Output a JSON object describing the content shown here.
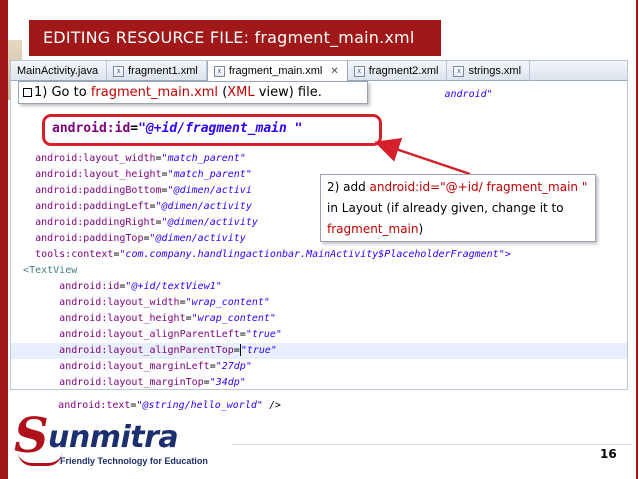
{
  "slide": {
    "title": "EDITING RESOURCE FILE: fragment_main.xml",
    "page_number": "16",
    "colors": {
      "accent": "#a01818",
      "callout_border": "#d4202a",
      "xml_value": "#2a00ff",
      "xml_attr": "#7f007f"
    }
  },
  "tabs": [
    {
      "label": "MainActivity.java",
      "active": false
    },
    {
      "label": "fragment1.xml",
      "active": false
    },
    {
      "label": "fragment_main.xml",
      "active": true
    },
    {
      "label": "fragment2.xml",
      "active": false
    },
    {
      "label": "strings.xml",
      "active": false
    }
  ],
  "code_lines": [
    {
      "attr": "android:layout_width",
      "val": "\"match_parent\""
    },
    {
      "attr": "android:layout_height",
      "val": "\"match_parent\""
    },
    {
      "attr": "android:paddingBottom",
      "val": "\"@dimen/activi"
    },
    {
      "attr": "android:paddingLeft",
      "val": "\"@dimen/activity"
    },
    {
      "attr": "android:paddingRight",
      "val": "\"@dimen/activity"
    },
    {
      "attr": "android:paddingTop",
      "val": "\"@dimen/activity"
    },
    {
      "attr": "tools:context",
      "val": "\"com.company.handlingactionbar.MainActivity$PlaceholderFragment\">"
    },
    {
      "tag": "<TextView"
    },
    {
      "attr": "android:id",
      "val": "\"@+id/textView1\""
    },
    {
      "attr": "android:layout_width",
      "val": "\"wrap_content\""
    },
    {
      "attr": "android:layout_height",
      "val": "\"wrap_content\""
    },
    {
      "attr": "android:layout_alignParentLeft",
      "val": "\"true\""
    },
    {
      "attr": "android:layout_alignParentTop",
      "val": "\"true\""
    },
    {
      "attr": "android:layout_marginLeft",
      "val": "\"27dp\""
    },
    {
      "attr": "android:layout_marginTop",
      "val": "\"34dp\""
    },
    {
      "attr": "android:text",
      "val": "\"@string/hello_world\"",
      "tail": " />"
    }
  ],
  "step1": {
    "prefix": "1) Go to ",
    "file": "fragment_main.xml",
    "paren_open": " (",
    "mode": "XML",
    "suffix": " view) file.",
    "behind_text": "android\""
  },
  "highlight": {
    "attr": "android:id",
    "equals": "=",
    "value": "\"@+id/fragment_main \""
  },
  "step2": {
    "t1": "2) add ",
    "r1": "android:id=\"@+id/",
    "r2": "fragment_main \"",
    "t2": " in  Layout (if already given, change it to ",
    "r3": "fragment_main",
    "t3": ")"
  },
  "logo": {
    "letter": "S",
    "word": "unmitra",
    "tagline": "Friendly Technology for Education"
  }
}
